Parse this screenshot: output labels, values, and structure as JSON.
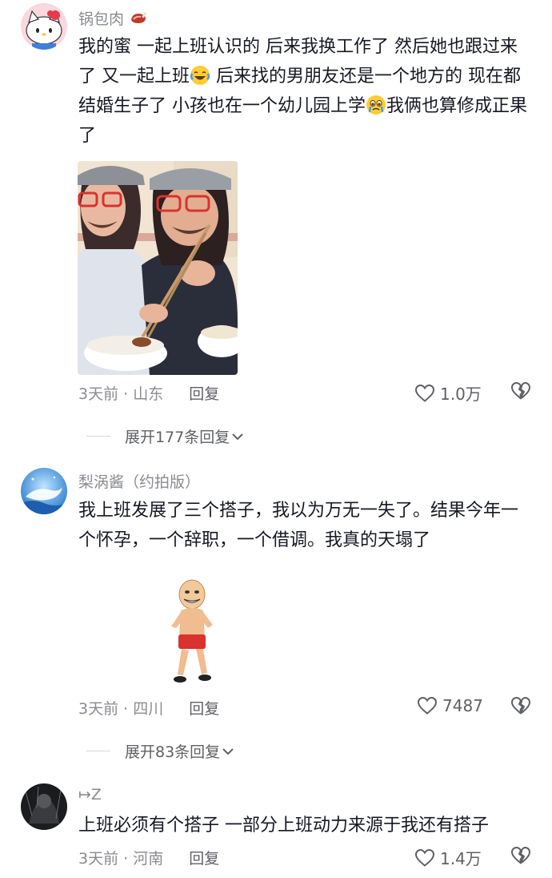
{
  "comments": [
    {
      "username": "锅包肉",
      "text_1": "我的蜜 一起上班认识的 后来我换工作了 然后她也跟过来了 又一起上班",
      "text_2": " 后来找的男朋友还是一个地方的 现在都结婚生子了 小孩也在一个幼儿园上学",
      "text_3": "我俩也算修成正果了",
      "time": "3天前",
      "location": "山东",
      "reply": "回复",
      "likes": "1.0万",
      "expand": "展开177条回复"
    },
    {
      "username": "梨涡酱（约拍版）",
      "text": "我上班发展了三个搭子，我以为万无一失了。结果今年一个怀孕，一个辞职，一个借调。我真的天塌了",
      "time": "3天前",
      "location": "四川",
      "reply": "回复",
      "likes": "7487",
      "expand": "展开83条回复"
    },
    {
      "username": "↦Z",
      "text": "上班必须有个搭子 一部分上班动力来源于我还有搭子",
      "time": "3天前",
      "location": "河南",
      "reply": "回复",
      "likes": "1.4万"
    }
  ],
  "colors": {
    "text": "#161823",
    "secondary": "#8a8b91",
    "icon": "#5f6066"
  },
  "icons": [
    "heart-outline-icon",
    "broken-heart-icon",
    "chevron-down-icon",
    "meat-emoji-icon",
    "laugh-cry-emoji-icon",
    "cry-emoji-icon"
  ]
}
